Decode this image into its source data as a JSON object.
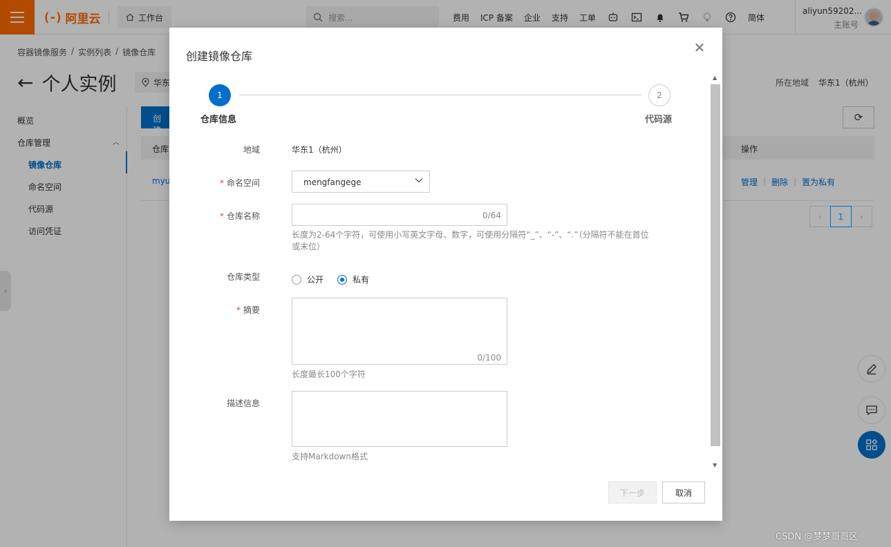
{
  "topbar": {
    "logo_text": "阿里云",
    "workbench": "工作台",
    "search_placeholder": "搜索...",
    "links": [
      "费用",
      "ICP 备案",
      "企业",
      "支持",
      "工单"
    ],
    "lang": "简体",
    "username": "aliyun59202...",
    "role": "主账号"
  },
  "page": {
    "breadcrumb": [
      "容器镜像服务",
      "/",
      "实例列表",
      "/",
      "镜像仓库"
    ],
    "title": "个人实例",
    "region_chip": "华东",
    "region_label": "所在地域",
    "region_value": "华东1（杭州）"
  },
  "sidenav": {
    "overview": "概览",
    "repo_mgmt": "仓库管理",
    "items": [
      "镜像仓库",
      "命名空间",
      "代码源",
      "访问凭证"
    ]
  },
  "table": {
    "create_label": "创建",
    "col_repo": "仓库",
    "col_actions": "操作",
    "row_name": "myu",
    "actions": [
      "管理",
      "删除",
      "置为私有"
    ],
    "page_current": "1"
  },
  "modal": {
    "title": "创建镜像仓库",
    "steps": [
      {
        "num": "1",
        "label": "仓库信息"
      },
      {
        "num": "2",
        "label": "代码源"
      }
    ],
    "fields": {
      "region_label": "地域",
      "region_value": "华东1（杭州）",
      "namespace_label": "命名空间",
      "namespace_value": "mengfangege",
      "repo_name_label": "仓库名称",
      "repo_name_counter": "0/64",
      "repo_name_help_1": "长度为2-64个字符，可使用小写英文字母、数字，可使用分隔符“_”、“-”、“.”（分隔符不能在首位",
      "repo_name_help_2": "或末位）",
      "repo_type_label": "仓库类型",
      "repo_type_options": [
        "公开",
        "私有"
      ],
      "repo_type_selected": "私有",
      "summary_label": "摘要",
      "summary_counter": "0/100",
      "summary_help": "长度最长100个字符",
      "description_label": "描述信息",
      "description_help": "支持Markdown格式"
    },
    "buttons": {
      "next": "下一步",
      "cancel": "取消"
    }
  },
  "watermark": "CSDN @梦梦哥哥区",
  "colors": {
    "brand_orange": "#ff6a00",
    "primary_blue": "#0070cc",
    "required_red": "#e5413b"
  }
}
